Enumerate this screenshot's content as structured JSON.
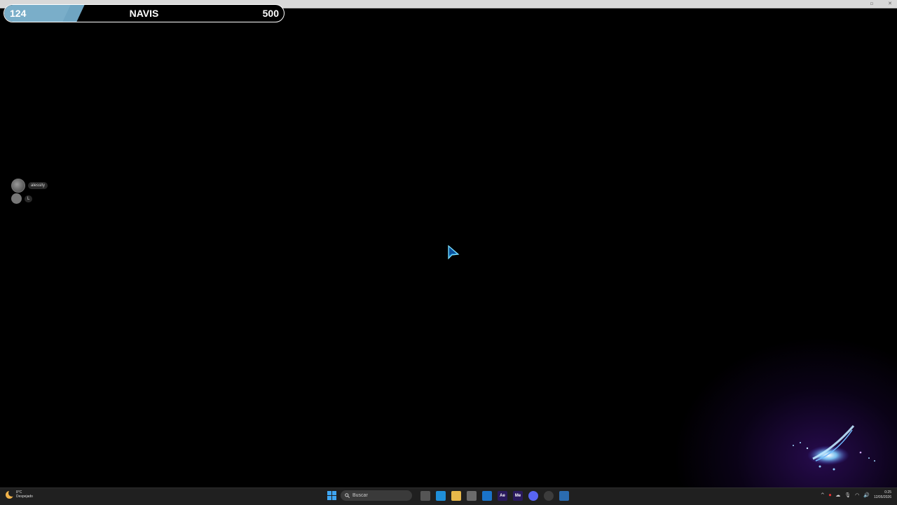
{
  "window": {
    "restore_glyph": "▫",
    "close_glyph": "✕"
  },
  "xp_bar": {
    "current": "124",
    "title": "NAVIS",
    "max": "500",
    "progress_fraction": 0.248,
    "fill_color": "#7aaec9"
  },
  "players": [
    {
      "name": "alessity",
      "avatar": "avatar-icon"
    },
    {
      "name": "L",
      "avatar": "avatar-icon"
    }
  ],
  "taskbar": {
    "weather": {
      "temp": "8°C",
      "condition": "Despejado",
      "icon": "moon-icon"
    },
    "search_placeholder": "Buscar",
    "apps": [
      {
        "name": "task-view-icon",
        "label": "",
        "color": "#555555"
      },
      {
        "name": "edge-icon",
        "label": "",
        "color": "#1f8fd9"
      },
      {
        "name": "file-explorer-icon",
        "label": "",
        "color": "#e8b84a"
      },
      {
        "name": "store-icon",
        "label": "",
        "color": "#6b6b6b"
      },
      {
        "name": "outlook-icon",
        "label": "",
        "color": "#1a73c9"
      },
      {
        "name": "after-effects-icon",
        "label": "Ae",
        "color": "#2a1a5e"
      },
      {
        "name": "media-encoder-icon",
        "label": "Me",
        "color": "#2a1a5e"
      },
      {
        "name": "discord-icon",
        "label": "",
        "color": "#5865f2"
      },
      {
        "name": "chrome-icon",
        "label": "",
        "color": "#3c3c3c"
      },
      {
        "name": "pen-app-icon",
        "label": "",
        "color": "#2b6cb0"
      }
    ],
    "tray": {
      "chevron": "^",
      "time": "0:25",
      "date": "12/05/2026"
    }
  }
}
